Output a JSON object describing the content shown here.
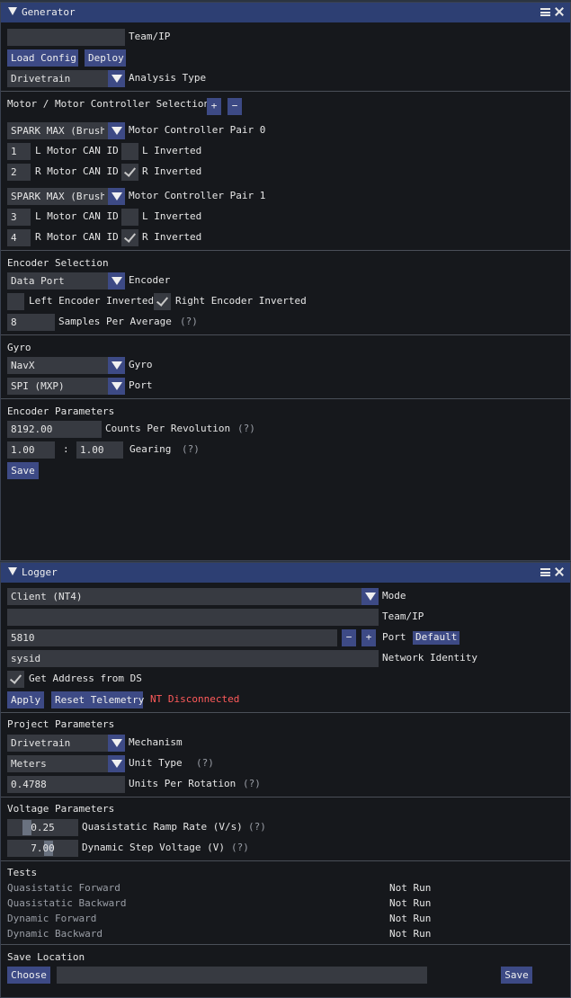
{
  "generator": {
    "title": "Generator",
    "team_ip": {
      "value": "",
      "label": "Team/IP"
    },
    "load_config": "Load Config",
    "deploy": "Deploy",
    "analysis_type": {
      "value": "Drivetrain",
      "label": "Analysis Type"
    },
    "motor_section": "Motor / Motor Controller Selection",
    "plus": "+",
    "minus": "−",
    "pairs": [
      {
        "controller": "SPARK MAX (Brushless)",
        "label": "Motor Controller Pair 0",
        "l_id": "1",
        "l_id_label": "L Motor CAN ID",
        "l_inv_label": "L Inverted",
        "l_inv": false,
        "r_id": "2",
        "r_id_label": "R Motor CAN ID",
        "r_inv_label": "R Inverted",
        "r_inv": true
      },
      {
        "controller": "SPARK MAX (Brushless)",
        "label": "Motor Controller Pair 1",
        "l_id": "3",
        "l_id_label": "L Motor CAN ID",
        "l_inv_label": "L Inverted",
        "l_inv": false,
        "r_id": "4",
        "r_id_label": "R Motor CAN ID",
        "r_inv_label": "R Inverted",
        "r_inv": true
      }
    ],
    "encoder_section": "Encoder Selection",
    "encoder": {
      "value": "Data Port",
      "label": "Encoder"
    },
    "left_enc_inv": {
      "label": "Left Encoder Inverted",
      "checked": false
    },
    "right_enc_inv": {
      "label": "Right Encoder Inverted",
      "checked": true
    },
    "samples": {
      "value": "8",
      "label": "Samples Per Average",
      "help": "(?)"
    },
    "gyro_section": "Gyro",
    "gyro": {
      "value": "NavX",
      "label": "Gyro"
    },
    "port": {
      "value": "SPI (MXP)",
      "label": "Port"
    },
    "enc_params_section": "Encoder Parameters",
    "cpr": {
      "value": "8192.00",
      "label": "Counts Per Revolution",
      "help": "(?)"
    },
    "gearing": {
      "a": "1.00",
      "sep": ":",
      "b": "1.00",
      "label": "Gearing",
      "help": "(?)"
    },
    "save": "Save"
  },
  "logger": {
    "title": "Logger",
    "mode": {
      "value": "Client (NT4)",
      "label": "Mode"
    },
    "team_ip": {
      "value": "",
      "label": "Team/IP"
    },
    "port": {
      "value": "5810",
      "minus": "−",
      "plus": "+",
      "label": "Port",
      "default": "Default"
    },
    "network_identity": {
      "value": "sysid",
      "label": "Network Identity"
    },
    "get_address": {
      "label": "Get Address from DS",
      "checked": true
    },
    "apply": "Apply",
    "reset_telemetry": "Reset Telemetry",
    "nt_status": "NT Disconnected",
    "project_section": "Project Parameters",
    "mechanism": {
      "value": "Drivetrain",
      "label": "Mechanism"
    },
    "unit_type": {
      "value": "Meters",
      "label": "Unit Type",
      "help": "(?)"
    },
    "units_per_rotation": {
      "value": "0.4788",
      "label": "Units Per Rotation",
      "help": "(?)"
    },
    "voltage_section": "Voltage Parameters",
    "ramp_rate": {
      "value": "0.25",
      "level": 0.25,
      "label": "Quasistatic Ramp Rate (V/s)",
      "help": "(?)"
    },
    "step_voltage": {
      "value": "7.00",
      "level": 0.6,
      "label": "Dynamic Step Voltage (V)",
      "help": "(?)"
    },
    "tests_section": "Tests",
    "tests": [
      {
        "name": "Quasistatic Forward",
        "status": "Not Run"
      },
      {
        "name": "Quasistatic Backward",
        "status": "Not Run"
      },
      {
        "name": "Dynamic Forward",
        "status": "Not Run"
      },
      {
        "name": "Dynamic Backward",
        "status": "Not Run"
      }
    ],
    "save_location_section": "Save Location",
    "choose": "Choose",
    "save_path": "",
    "save": "Save"
  }
}
